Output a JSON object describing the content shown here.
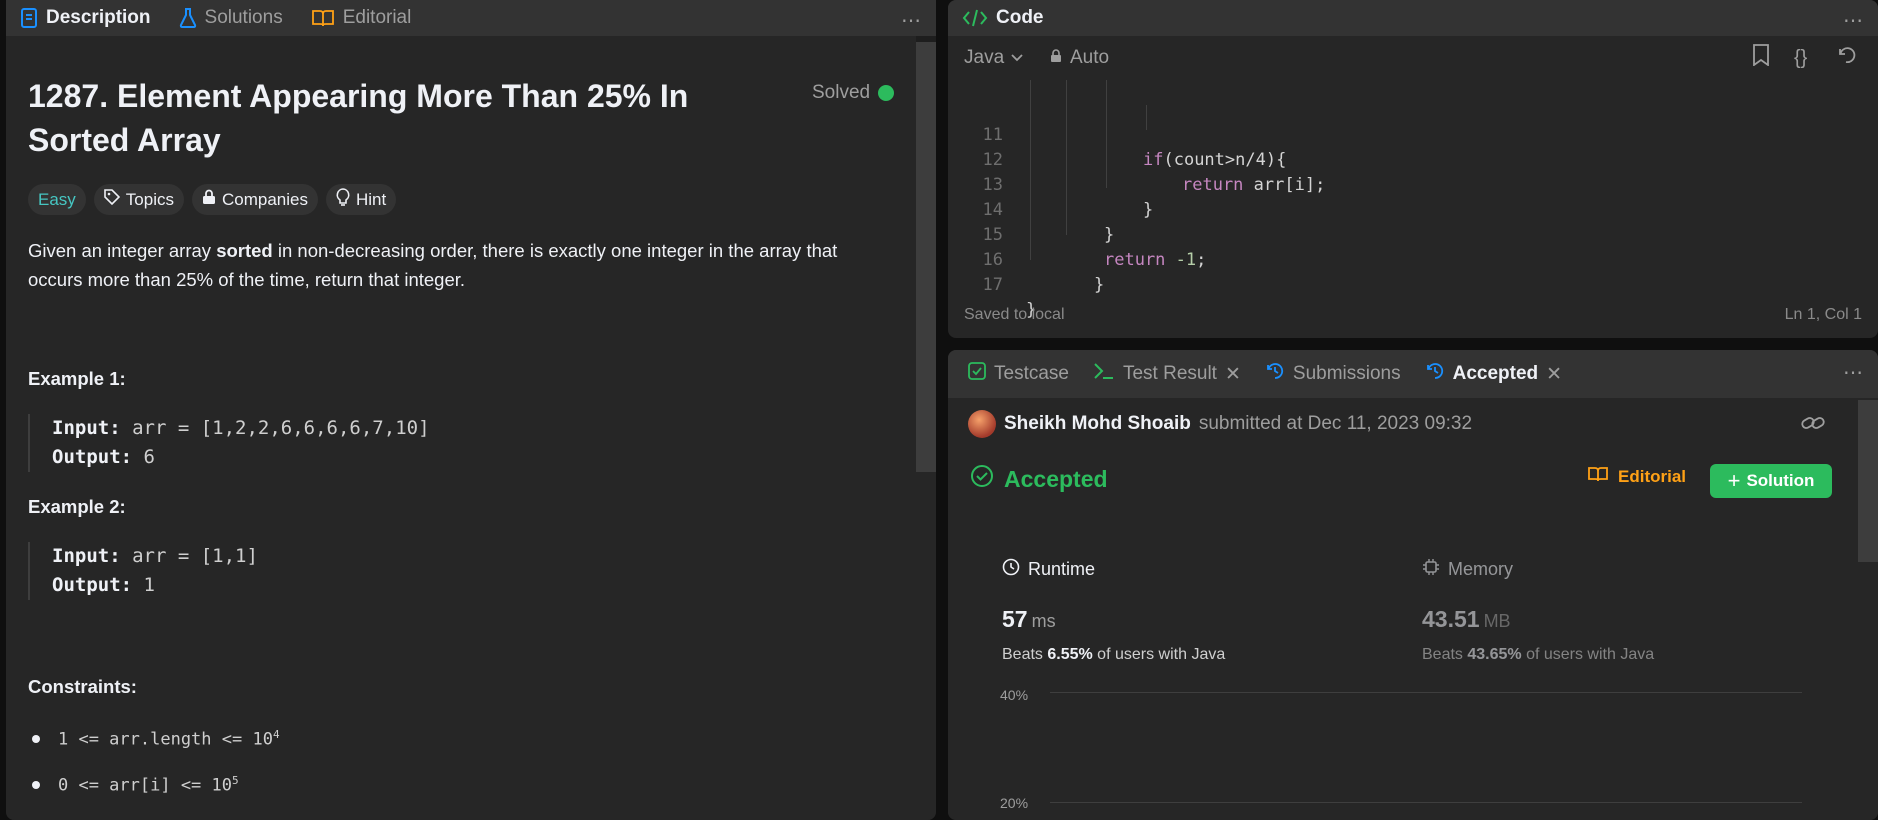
{
  "description_panel": {
    "tabs": [
      {
        "label": "Description"
      },
      {
        "label": "Solutions"
      },
      {
        "label": "Editorial"
      }
    ],
    "title": "1287. Element Appearing More Than 25% In Sorted Array",
    "status": "Solved",
    "chips": {
      "difficulty": "Easy",
      "topics": "Topics",
      "companies": "Companies",
      "hint": "Hint"
    },
    "description_pre": "Given an integer array ",
    "description_bold": "sorted",
    "description_post": " in non-decreasing order, there is exactly one integer in the array that occurs more than 25% of the time, return that integer.",
    "examples": [
      {
        "heading": "Example 1:",
        "input_label": "Input:",
        "input": "arr = [1,2,2,6,6,6,6,7,10]",
        "output_label": "Output:",
        "output": "6"
      },
      {
        "heading": "Example 2:",
        "input_label": "Input:",
        "input": "arr = [1,1]",
        "output_label": "Output:",
        "output": "1"
      }
    ],
    "constraints_heading": "Constraints:",
    "constraints": [
      {
        "text": "1 <= arr.length <= 10",
        "sup": "4"
      },
      {
        "text": "0 <= arr[i] <= 10",
        "sup": "5"
      }
    ]
  },
  "code_panel": {
    "title": "Code",
    "language": "Java",
    "mode": "Auto",
    "lines": [
      {
        "n": "11",
        "text": "if(count>n/4){"
      },
      {
        "n": "12",
        "text": "return arr[i];"
      },
      {
        "n": "13",
        "text": "}"
      },
      {
        "n": "14",
        "text": "}"
      },
      {
        "n": "15",
        "text": "return -1;"
      },
      {
        "n": "16",
        "text": "}"
      },
      {
        "n": "17",
        "text": "}"
      }
    ],
    "footer_left": "Saved to local",
    "footer_right": "Ln 1, Col 1"
  },
  "result_panel": {
    "tabs": [
      {
        "label": "Testcase"
      },
      {
        "label": "Test Result"
      },
      {
        "label": "Submissions"
      },
      {
        "label": "Accepted"
      }
    ],
    "user": "Sheikh Mohd Shoaib",
    "submitted_text": "submitted at Dec 11, 2023 09:32",
    "verdict": "Accepted",
    "editorial_btn": "Editorial",
    "solution_btn": "Solution",
    "runtime": {
      "label": "Runtime",
      "value": "57",
      "unit": "ms",
      "beats_pre": "Beats ",
      "beats_pct": "6.55%",
      "beats_post": " of users with Java"
    },
    "memory": {
      "label": "Memory",
      "value": "43.51",
      "unit": "MB",
      "beats_pre": "Beats ",
      "beats_pct": "43.65%",
      "beats_post": " of users with Java"
    },
    "chart_axis": [
      "40%",
      "20%"
    ]
  },
  "colors": {
    "accepted": "#2cbb5d",
    "easy": "#46c6c2",
    "editorial": "#ffa116",
    "keyword": "#c586c0"
  }
}
